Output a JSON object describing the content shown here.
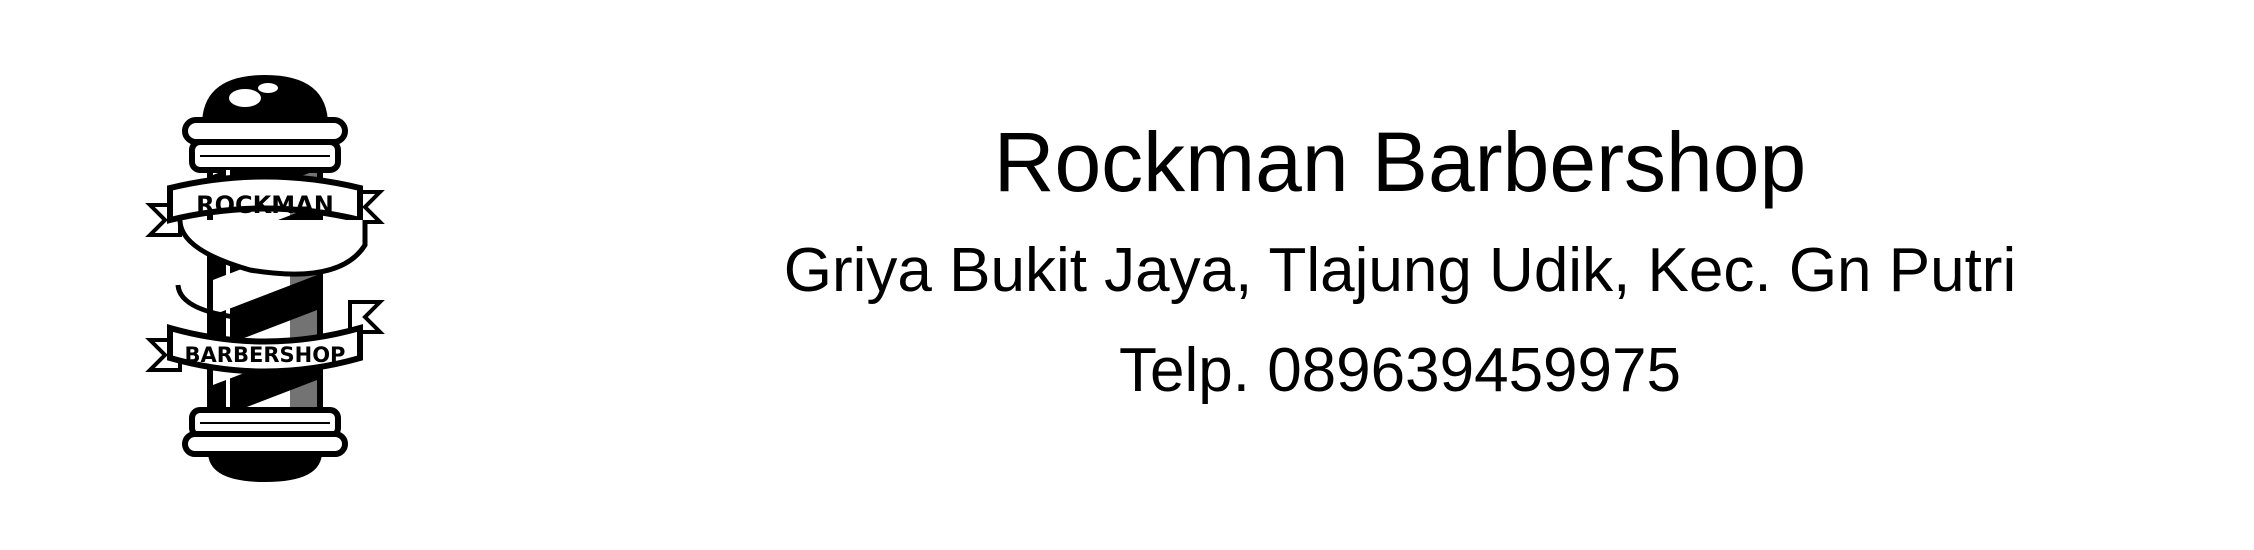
{
  "logo": {
    "icon": "barber-pole-icon",
    "line1": "ROCKMAN",
    "line2": "BARBERSHOP"
  },
  "header": {
    "title": "Rockman Barbershop",
    "address": "Griya Bukit Jaya, Tlajung Udik, Kec. Gn Putri",
    "phone": "Telp. 089639459975"
  }
}
